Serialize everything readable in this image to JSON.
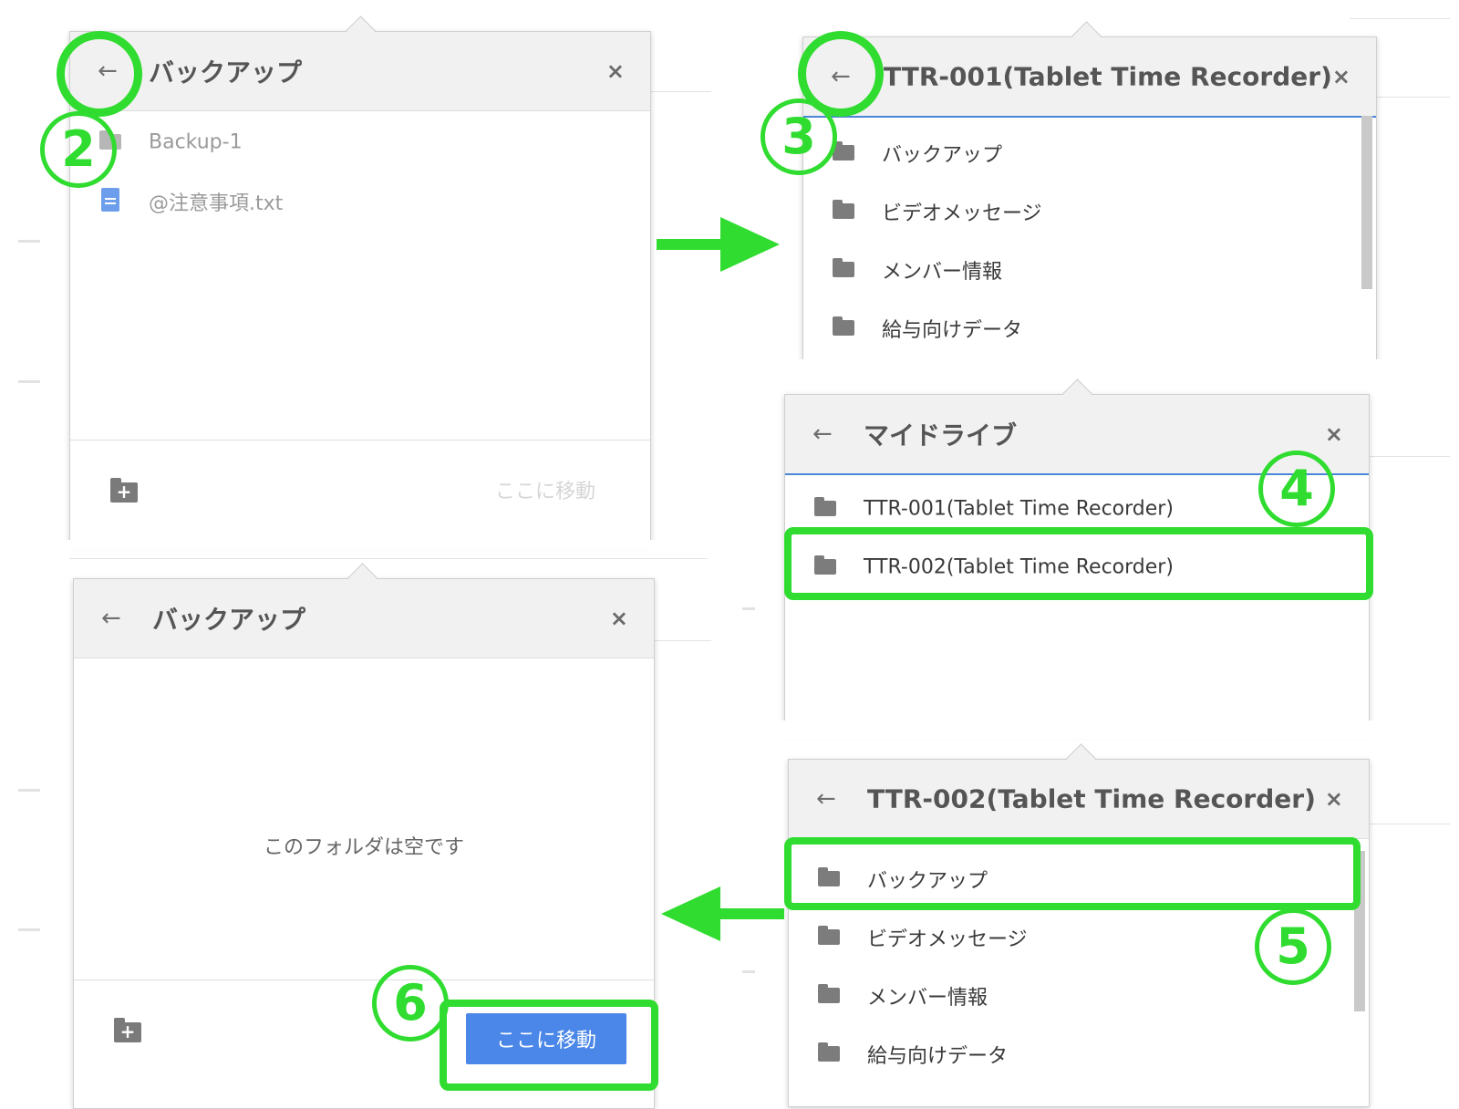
{
  "colors": {
    "highlight": "#2fdc2f",
    "header_bg": "#f1f1f1",
    "primary_button": "#4a87e8",
    "file_icon": "#6d9eeb",
    "focus_border": "#4a87d8"
  },
  "icons": {
    "back": "←",
    "close": "×",
    "new_folder_plus": "+"
  },
  "panel_a": {
    "title": "バックアップ",
    "items": [
      {
        "label": "Backup-1",
        "icon": "folder-icon"
      },
      {
        "label": "@注意事項.txt",
        "icon": "file-icon"
      }
    ],
    "move_label": "ここに移動"
  },
  "panel_b": {
    "title": "TTR-001(Tablet Time Recorder)",
    "items": [
      {
        "label": "バックアップ"
      },
      {
        "label": "ビデオメッセージ"
      },
      {
        "label": "メンバー情報"
      },
      {
        "label": "給与向けデータ"
      }
    ]
  },
  "panel_c": {
    "title": "マイドライブ",
    "items": [
      {
        "label": "TTR-001(Tablet Time Recorder)"
      },
      {
        "label": "TTR-002(Tablet Time Recorder)"
      }
    ]
  },
  "panel_d": {
    "title": "TTR-002(Tablet Time Recorder)",
    "items": [
      {
        "label": "バックアップ"
      },
      {
        "label": "ビデオメッセージ"
      },
      {
        "label": "メンバー情報"
      },
      {
        "label": "給与向けデータ"
      }
    ]
  },
  "panel_e": {
    "title": "バックアップ",
    "empty_message": "このフォルダは空です",
    "move_button": "ここに移動"
  },
  "steps": {
    "s2": "2",
    "s3": "3",
    "s4": "4",
    "s5": "5",
    "s6": "6"
  }
}
